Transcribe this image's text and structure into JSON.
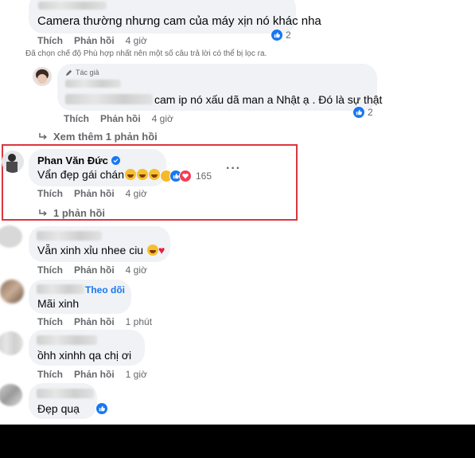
{
  "comments": {
    "c1": {
      "text": "Camera thường nhưng cam của máy xịn nó khác nha",
      "like": "Thích",
      "reply": "Phản hồi",
      "time": "4 giờ",
      "reaction_count": "2"
    },
    "filter_note": "Đã chọn chế độ Phù hợp nhất nên một số câu trả lời có thể bị lọc ra.",
    "author_reply": {
      "badge": "Tác giả",
      "text": "cam ip nó xấu dã man a Nhật ạ . Đó là sự thật",
      "like": "Thích",
      "reply": "Phản hồi",
      "time": "4 giờ",
      "reaction_count": "2"
    },
    "see_more": "Xem thêm 1 phản hồi",
    "c2": {
      "name": "Phan Văn Đức",
      "text": "Vẩn đẹp gái chán",
      "like": "Thích",
      "reply": "Phản hồi",
      "time": "4 giờ",
      "reaction_count": "165",
      "replies": "1 phản hồi"
    },
    "c3": {
      "text": "Vẫn xinh xỉu nhee ciu",
      "like": "Thích",
      "reply": "Phản hồi",
      "time": "4 giờ"
    },
    "c4": {
      "follow": "Theo dõi",
      "text": "Mãi xinh",
      "like": "Thích",
      "reply": "Phản hồi",
      "time": "1 phút"
    },
    "c5": {
      "text": "ồhh xinhh qa chị ơi",
      "like": "Thích",
      "reply": "Phản hồi",
      "time": "1 giờ"
    },
    "c6": {
      "text": "Đẹp quạ"
    }
  },
  "colors": {
    "accent": "#1877f2",
    "highlight": "#d9363e",
    "bubble": "#f0f2f5",
    "muted": "#65676b"
  },
  "icons": [
    "like-reaction-icon",
    "heart-reaction-icon",
    "haha-reaction-icon",
    "reply-arrow-icon",
    "pen-icon",
    "verified-badge-icon",
    "more-options-icon"
  ]
}
